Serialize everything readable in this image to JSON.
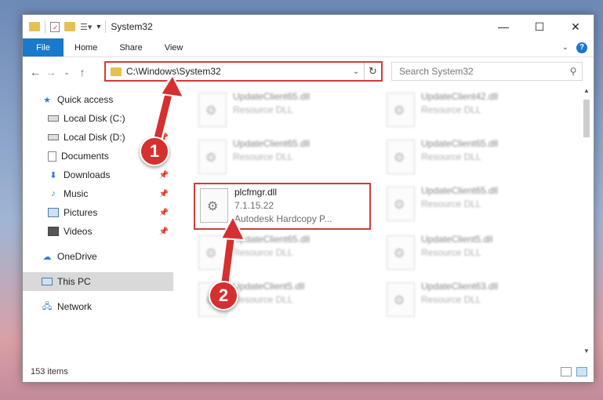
{
  "window": {
    "title": "System32"
  },
  "ribbon": {
    "file": "File",
    "home": "Home",
    "share": "Share",
    "view": "View",
    "help": "?"
  },
  "nav": {
    "path": "C:\\Windows\\System32",
    "search_placeholder": "Search System32"
  },
  "sidebar": {
    "items": [
      {
        "label": "Quick access",
        "icon": "star-icon",
        "level": 0
      },
      {
        "label": "Local Disk (C:)",
        "icon": "drive-icon",
        "level": 1,
        "pinned": true
      },
      {
        "label": "Local Disk (D:)",
        "icon": "drive-icon",
        "level": 1,
        "pinned": true
      },
      {
        "label": "Documents",
        "icon": "documents-icon",
        "level": 1,
        "pinned": true
      },
      {
        "label": "Downloads",
        "icon": "download-icon",
        "level": 1,
        "pinned": true
      },
      {
        "label": "Music",
        "icon": "music-icon",
        "level": 1,
        "pinned": true
      },
      {
        "label": "Pictures",
        "icon": "pictures-icon",
        "level": 1,
        "pinned": true
      },
      {
        "label": "Videos",
        "icon": "videos-icon",
        "level": 1,
        "pinned": true
      },
      {
        "label": "OneDrive",
        "icon": "cloud-icon",
        "level": 0
      },
      {
        "label": "This PC",
        "icon": "pc-icon",
        "level": 0,
        "selected": true
      },
      {
        "label": "Network",
        "icon": "network-icon",
        "level": 0
      }
    ]
  },
  "files": {
    "c1r1": {
      "name": "UpdateClient65.dll",
      "sub": "Resource DLL"
    },
    "c2r1": {
      "name": "UpdateClient42.dll",
      "sub": "Resource DLL"
    },
    "c1r2": {
      "name": "UpdateClient65.dll",
      "sub": "Resource DLL"
    },
    "c2r2": {
      "name": "UpdateClient65.dll",
      "sub": "Resource DLL"
    },
    "target": {
      "name": "plcfmgr.dll",
      "version": "7.1.15.22",
      "desc": "Autodesk Hardcopy P..."
    },
    "c2r3": {
      "name": "UpdateClient65.dll",
      "sub": "Resource DLL"
    },
    "c1r4": {
      "name": "UpdateClient65.dll",
      "sub": "Resource DLL"
    },
    "c2r4": {
      "name": "UpdateClient5.dll",
      "sub": "Resource DLL"
    },
    "c1r5": {
      "name": "UpdateClient5.dll",
      "sub": "Resource DLL"
    },
    "c2r5": {
      "name": "UpdateClient63.dll",
      "sub": "Resource DLL"
    }
  },
  "status": {
    "count": "153 items"
  },
  "markers": {
    "one": "1",
    "two": "2"
  },
  "colors": {
    "accent": "#1979ca",
    "highlight": "#d13b3b"
  }
}
